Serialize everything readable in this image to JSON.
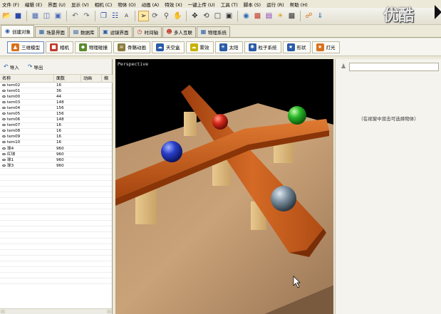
{
  "menu": [
    "文件 (F)",
    "编辑 (E)",
    "界面 (U)",
    "显示 (V)",
    "相机 (C)",
    "物体 (O)",
    "动画 (A)",
    "特效 (X)",
    "一键上传 (U)",
    "工具 (T)",
    "脚本 (S)",
    "运行 (R)",
    "帮助 (H)"
  ],
  "toolbar_icons": [
    "open-icon",
    "save-icon",
    "grid-icon",
    "layout-icon",
    "window-icon",
    "undo-icon",
    "redo-icon",
    "copy-icon",
    "paste-icon",
    "text-icon",
    "select-icon",
    "rotate-view-icon",
    "zoom-icon",
    "pan-icon",
    "move-icon",
    "rotate-icon",
    "scale-icon",
    "snap-icon",
    "render-icon",
    "material-icon",
    "texture-icon",
    "light-icon",
    "camera-icon",
    "script-icon",
    "publish-icon"
  ],
  "watermark": "优酷",
  "main_tabs": [
    {
      "label": "创建对象",
      "icon": "create-icon",
      "active": true
    },
    {
      "label": "场景界面",
      "icon": "scene-icon",
      "active": false
    },
    {
      "label": "数据库",
      "icon": "database-icon",
      "active": false
    },
    {
      "label": "滤镜界面",
      "icon": "filter-icon",
      "active": false
    },
    {
      "label": "时间轴",
      "icon": "timeline-icon",
      "active": false
    },
    {
      "label": "多人互联",
      "icon": "multiplayer-icon",
      "active": false
    },
    {
      "label": "物理系统",
      "icon": "physics-icon",
      "active": false
    }
  ],
  "sub_tabs": [
    {
      "label": "三维模型",
      "icon": "model-icon",
      "color": "#d9711c",
      "active": true
    },
    {
      "label": "相机",
      "icon": "camera-icon",
      "color": "#c0392b",
      "active": false
    },
    {
      "label": "物理碰撞",
      "icon": "collision-icon",
      "color": "#5a8a2c",
      "active": false
    },
    {
      "label": "骨骼动画",
      "icon": "bone-icon",
      "color": "#8a7a3c",
      "active": false
    },
    {
      "label": "天空盒",
      "icon": "skybox-icon",
      "color": "#2a5aa8",
      "active": false
    },
    {
      "label": "雾效",
      "icon": "fog-icon",
      "color": "#c9b100",
      "active": false
    },
    {
      "label": "太阳",
      "icon": "sun-icon",
      "color": "#2a5aa8",
      "active": false
    },
    {
      "label": "粒子系统",
      "icon": "particle-icon",
      "color": "#2a5aa8",
      "active": false
    },
    {
      "label": "形状",
      "icon": "shape-icon",
      "color": "#2a5aa8",
      "active": false
    },
    {
      "label": "灯光",
      "icon": "light-icon",
      "color": "#d9711c",
      "active": false
    }
  ],
  "left_panel": {
    "import_label": "导入",
    "export_label": "导出",
    "columns": [
      "名称",
      "面数",
      "动画",
      "缩"
    ],
    "rows": [
      {
        "name": "tem02",
        "faces": "16"
      },
      {
        "name": "tem01",
        "faces": "36"
      },
      {
        "name": "tem00",
        "faces": "44"
      },
      {
        "name": "tem03",
        "faces": "148"
      },
      {
        "name": "tem04",
        "faces": "156"
      },
      {
        "name": "tem05",
        "faces": "156"
      },
      {
        "name": "tem06",
        "faces": "148"
      },
      {
        "name": "tem07",
        "faces": "16"
      },
      {
        "name": "tem08",
        "faces": "16"
      },
      {
        "name": "tem09",
        "faces": "16"
      },
      {
        "name": "tem10",
        "faces": "16"
      },
      {
        "name": "球4",
        "faces": "960"
      },
      {
        "name": "红球",
        "faces": "960"
      },
      {
        "name": "球1",
        "faces": "960"
      },
      {
        "name": "球3",
        "faces": "960"
      }
    ]
  },
  "viewport": {
    "label": "Perspective"
  },
  "right_panel": {
    "hint": "（在视窗中双击可选择物体）"
  }
}
